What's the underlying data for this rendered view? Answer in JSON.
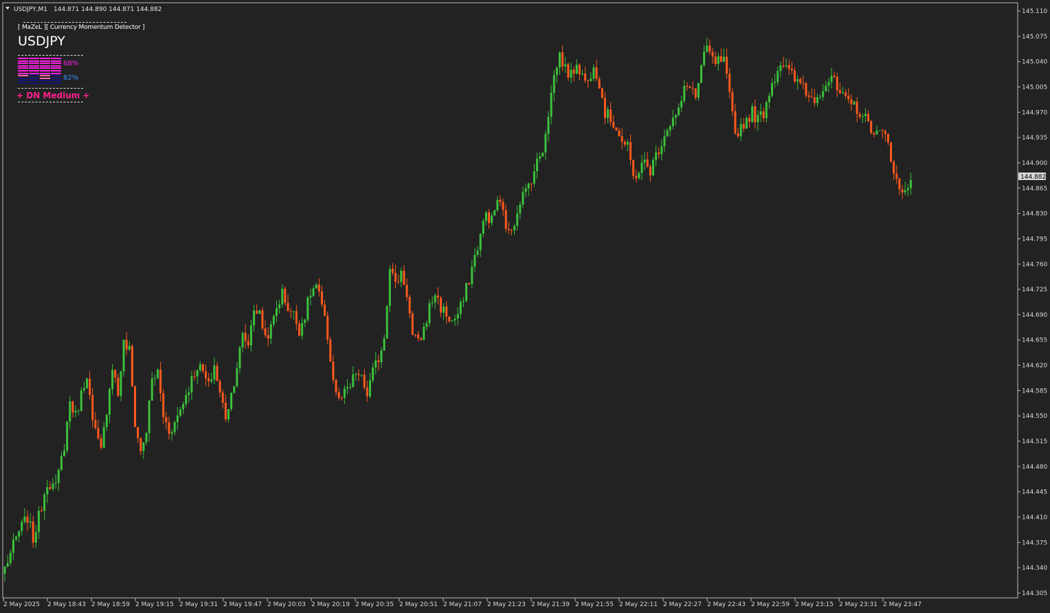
{
  "header": {
    "symbol_tf": "USDJPY,M1",
    "ohlc": "144.871 144.890 144.871 144.882"
  },
  "indicator": {
    "title": "[ MaZeL ][ Currency Momentum Detector ]",
    "symbol": "USDJPY",
    "upper_pct": "68%",
    "lower_pct": "82%",
    "signal": "+ DN Medium +",
    "colors": {
      "magenta": "#ff1ee6",
      "pink": "#ff6aa8",
      "navy": "#14147a",
      "signal": "#ff1e8c",
      "blue": "#3b8cff"
    }
  },
  "price_tag": "144.882",
  "chart_data": {
    "type": "candlestick",
    "colors": {
      "up": "#3cc23c",
      "down": "#ff5a1e",
      "background": "#222222",
      "axis": "#cfcfcf"
    },
    "ylim": [
      144.305,
      145.11
    ],
    "y_ticks": [
      "145.110",
      "145.075",
      "145.040",
      "145.005",
      "144.970",
      "144.935",
      "144.900",
      "144.865",
      "144.830",
      "144.795",
      "144.760",
      "144.725",
      "144.690",
      "144.655",
      "144.620",
      "144.585",
      "144.550",
      "144.515",
      "144.480",
      "144.445",
      "144.410",
      "144.375",
      "144.340",
      "144.305"
    ],
    "x_ticks": [
      "2 May 2025",
      "2 May 18:43",
      "2 May 18:59",
      "2 May 19:15",
      "2 May 19:31",
      "2 May 19:47",
      "2 May 20:03",
      "2 May 20:19",
      "2 May 20:35",
      "2 May 20:51",
      "2 May 21:07",
      "2 May 21:23",
      "2 May 21:39",
      "2 May 21:55",
      "2 May 22:11",
      "2 May 22:27",
      "2 May 22:43",
      "2 May 22:59",
      "2 May 23:15",
      "2 May 23:31",
      "2 May 23:47"
    ],
    "close_waypoints": [
      [
        0,
        144.34
      ],
      [
        3,
        144.37
      ],
      [
        5,
        144.39
      ],
      [
        8,
        144.41
      ],
      [
        10,
        144.38
      ],
      [
        12,
        144.41
      ],
      [
        15,
        144.46
      ],
      [
        18,
        144.45
      ],
      [
        21,
        144.51
      ],
      [
        23,
        144.57
      ],
      [
        25,
        144.55
      ],
      [
        27,
        144.58
      ],
      [
        29,
        144.61
      ],
      [
        31,
        144.54
      ],
      [
        34,
        144.5
      ],
      [
        36,
        144.56
      ],
      [
        38,
        144.62
      ],
      [
        40,
        144.58
      ],
      [
        42,
        144.65
      ],
      [
        44,
        144.64
      ],
      [
        46,
        144.54
      ],
      [
        48,
        144.5
      ],
      [
        50,
        144.53
      ],
      [
        52,
        144.6
      ],
      [
        54,
        144.61
      ],
      [
        56,
        144.55
      ],
      [
        58,
        144.53
      ],
      [
        60,
        144.54
      ],
      [
        62,
        144.56
      ],
      [
        64,
        144.58
      ],
      [
        66,
        144.6
      ],
      [
        68,
        144.62
      ],
      [
        70,
        144.61
      ],
      [
        72,
        144.59
      ],
      [
        74,
        144.62
      ],
      [
        76,
        144.58
      ],
      [
        78,
        144.55
      ],
      [
        80,
        144.58
      ],
      [
        82,
        144.62
      ],
      [
        84,
        144.66
      ],
      [
        86,
        144.65
      ],
      [
        88,
        144.7
      ],
      [
        90,
        144.69
      ],
      [
        92,
        144.66
      ],
      [
        94,
        144.67
      ],
      [
        96,
        144.7
      ],
      [
        98,
        144.72
      ],
      [
        100,
        144.7
      ],
      [
        102,
        144.69
      ],
      [
        104,
        144.67
      ],
      [
        106,
        144.69
      ],
      [
        108,
        144.72
      ],
      [
        110,
        144.73
      ],
      [
        112,
        144.7
      ],
      [
        114,
        144.66
      ],
      [
        116,
        144.6
      ],
      [
        118,
        144.57
      ],
      [
        120,
        144.58
      ],
      [
        122,
        144.59
      ],
      [
        124,
        144.61
      ],
      [
        126,
        144.6
      ],
      [
        128,
        144.58
      ],
      [
        130,
        144.61
      ],
      [
        132,
        144.63
      ],
      [
        134,
        144.66
      ],
      [
        136,
        144.76
      ],
      [
        138,
        144.73
      ],
      [
        140,
        144.75
      ],
      [
        142,
        144.72
      ],
      [
        144,
        144.66
      ],
      [
        146,
        144.65
      ],
      [
        148,
        144.67
      ],
      [
        150,
        144.7
      ],
      [
        152,
        144.72
      ],
      [
        154,
        144.7
      ],
      [
        156,
        144.69
      ],
      [
        158,
        144.68
      ],
      [
        160,
        144.69
      ],
      [
        162,
        144.71
      ],
      [
        164,
        144.74
      ],
      [
        166,
        144.77
      ],
      [
        168,
        144.8
      ],
      [
        170,
        144.83
      ],
      [
        172,
        144.82
      ],
      [
        174,
        144.85
      ],
      [
        176,
        144.83
      ],
      [
        178,
        144.8
      ],
      [
        180,
        144.82
      ],
      [
        182,
        144.85
      ],
      [
        184,
        144.86
      ],
      [
        186,
        144.88
      ],
      [
        188,
        144.9
      ],
      [
        190,
        144.92
      ],
      [
        192,
        144.97
      ],
      [
        194,
        145.02
      ],
      [
        196,
        145.05
      ],
      [
        198,
        145.03
      ],
      [
        200,
        145.02
      ],
      [
        202,
        145.04
      ],
      [
        204,
        145.02
      ],
      [
        206,
        145.01
      ],
      [
        208,
        145.04
      ],
      [
        210,
        145.01
      ],
      [
        212,
        144.97
      ],
      [
        214,
        144.96
      ],
      [
        216,
        144.95
      ],
      [
        218,
        144.93
      ],
      [
        220,
        144.92
      ],
      [
        222,
        144.88
      ],
      [
        224,
        144.89
      ],
      [
        226,
        144.9
      ],
      [
        228,
        144.89
      ],
      [
        230,
        144.91
      ],
      [
        232,
        144.93
      ],
      [
        234,
        144.95
      ],
      [
        236,
        144.96
      ],
      [
        238,
        144.97
      ],
      [
        240,
        145.0
      ],
      [
        242,
        145.01
      ],
      [
        244,
        144.99
      ],
      [
        246,
        145.03
      ],
      [
        248,
        145.06
      ],
      [
        250,
        145.04
      ],
      [
        252,
        145.04
      ],
      [
        254,
        145.04
      ],
      [
        256,
        144.99
      ],
      [
        258,
        144.94
      ],
      [
        260,
        144.95
      ],
      [
        262,
        144.96
      ],
      [
        264,
        144.97
      ],
      [
        266,
        144.96
      ],
      [
        268,
        144.97
      ],
      [
        270,
        145.0
      ],
      [
        272,
        145.02
      ],
      [
        274,
        145.04
      ],
      [
        276,
        145.03
      ],
      [
        278,
        145.02
      ],
      [
        280,
        145.01
      ],
      [
        282,
        145.01
      ],
      [
        284,
        144.99
      ],
      [
        286,
        144.99
      ],
      [
        288,
        145.0
      ],
      [
        290,
        145.01
      ],
      [
        292,
        145.02
      ],
      [
        294,
        145.0
      ],
      [
        296,
        144.99
      ],
      [
        298,
        144.98
      ],
      [
        300,
        144.98
      ],
      [
        302,
        144.97
      ],
      [
        304,
        144.96
      ],
      [
        306,
        144.95
      ],
      [
        308,
        144.94
      ],
      [
        310,
        144.94
      ],
      [
        312,
        144.93
      ],
      [
        314,
        144.89
      ],
      [
        316,
        144.86
      ],
      [
        318,
        144.86
      ],
      [
        320,
        144.88
      ]
    ]
  }
}
